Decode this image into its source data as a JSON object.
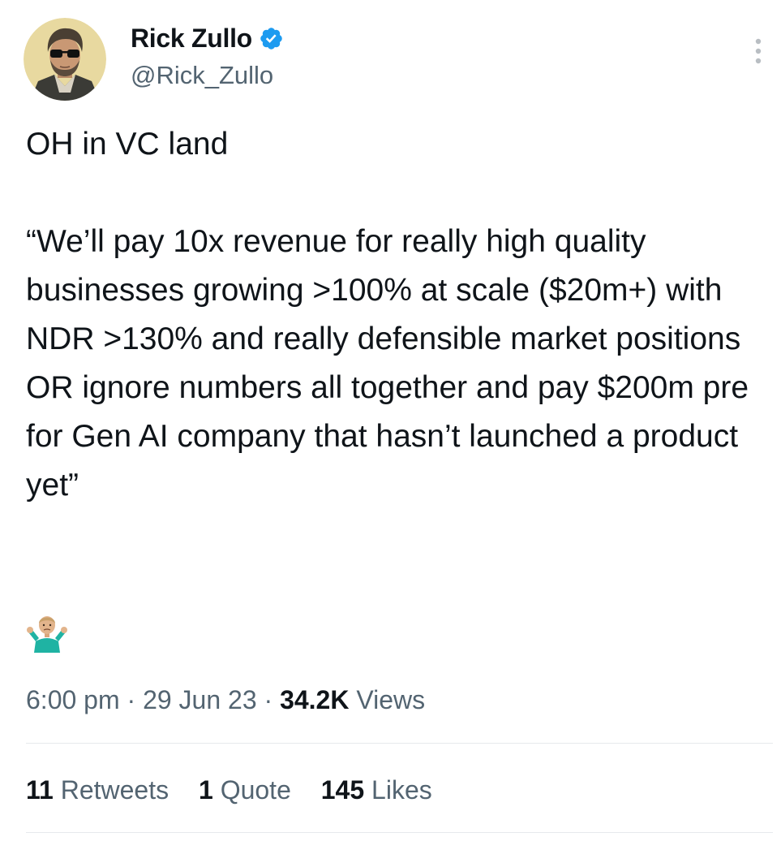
{
  "author": {
    "display_name": "Rick Zullo",
    "handle": "@Rick_Zullo",
    "avatar_icon": "avatar-man-with-sunglasses",
    "verified_icon": "verified-badge-icon",
    "verified_color": "#1d9bf0"
  },
  "more_icon": "more-vertical-icon",
  "tweet": {
    "text": "OH in VC land\n\n“We’ll pay 10x revenue for really high quality businesses growing >100% at scale ($20m+) with NDR >130% and really defensible market positions OR ignore numbers all together and pay $200m pre for Gen AI company that hasn’t launched a product yet”",
    "emoji": "🤷🏼‍♂️",
    "emoji_icon": "person-shrugging-emoji"
  },
  "meta": {
    "time": "6:00 pm",
    "separator": "·",
    "date": "29 Jun 23",
    "views_count": "34.2K",
    "views_label": "Views"
  },
  "stats": {
    "retweets_count": "11",
    "retweets_label": "Retweets",
    "quotes_count": "1",
    "quotes_label": "Quote",
    "likes_count": "145",
    "likes_label": "Likes"
  },
  "colors": {
    "text_primary": "#0f1419",
    "text_secondary": "#536471",
    "divider": "#e6e9ec",
    "accent": "#1d9bf0"
  }
}
